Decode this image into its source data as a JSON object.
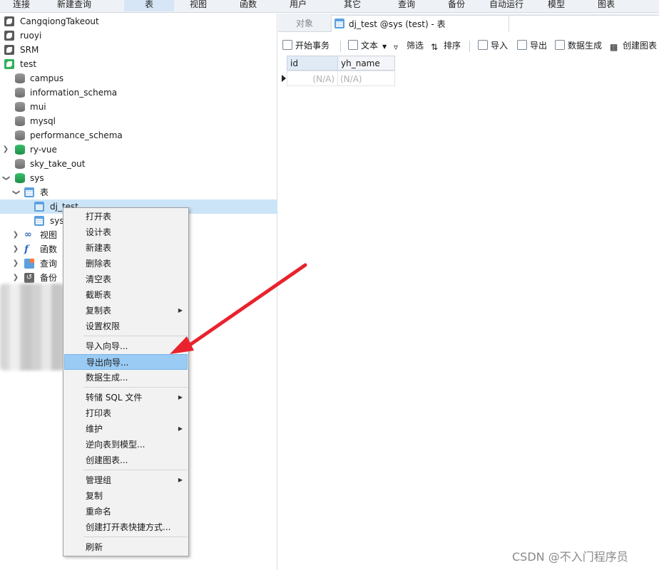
{
  "toolbar": {
    "items": [
      "连接",
      "新建查询",
      "表",
      "视图",
      "函数",
      "用户",
      "其它",
      "查询",
      "备份",
      "自动运行",
      "模型",
      "图表"
    ]
  },
  "tree": {
    "connections": [
      {
        "label": "CangqiongTakeout"
      },
      {
        "label": "ruoyi"
      },
      {
        "label": "SRM"
      },
      {
        "label": "test"
      }
    ],
    "databases": [
      {
        "label": "campus"
      },
      {
        "label": "information_schema"
      },
      {
        "label": "mui"
      },
      {
        "label": "mysql"
      },
      {
        "label": "performance_schema"
      },
      {
        "label": "ry-vue"
      },
      {
        "label": "sky_take_out"
      },
      {
        "label": "sys"
      }
    ],
    "sys_children": {
      "tables_label": "表",
      "tables": [
        "dj_test",
        "sys"
      ],
      "views_label": "视图",
      "functions_label": "函数",
      "queries_label": "查询",
      "backups_label": "备份"
    }
  },
  "tabs": {
    "objects": "对象",
    "active": "dj_test @sys (test) - 表"
  },
  "actions": {
    "begin_transaction": "开始事务",
    "text": "文本",
    "filter": "筛选",
    "sort": "排序",
    "import": "导入",
    "export": "导出",
    "data_generation": "数据生成",
    "create_chart": "创建图表"
  },
  "grid": {
    "columns": [
      "id",
      "yh_name"
    ],
    "rows": [
      [
        "(N/A)",
        "(N/A)"
      ]
    ]
  },
  "context_menu": {
    "groups": [
      [
        {
          "label": "打开表",
          "submenu": false
        },
        {
          "label": "设计表",
          "submenu": false
        },
        {
          "label": "新建表",
          "submenu": false
        },
        {
          "label": "删除表",
          "submenu": false
        },
        {
          "label": "清空表",
          "submenu": false
        },
        {
          "label": "截断表",
          "submenu": false
        },
        {
          "label": "复制表",
          "submenu": true
        },
        {
          "label": "设置权限",
          "submenu": false
        }
      ],
      [
        {
          "label": "导入向导...",
          "submenu": false
        },
        {
          "label": "导出向导...",
          "submenu": false,
          "highlighted": true
        },
        {
          "label": "数据生成...",
          "submenu": false
        }
      ],
      [
        {
          "label": "转储 SQL 文件",
          "submenu": true
        },
        {
          "label": "打印表",
          "submenu": false
        },
        {
          "label": "维护",
          "submenu": true
        },
        {
          "label": "逆向表到模型...",
          "submenu": false
        },
        {
          "label": "创建图表...",
          "submenu": false
        }
      ],
      [
        {
          "label": "管理组",
          "submenu": true
        },
        {
          "label": "复制",
          "submenu": false
        },
        {
          "label": "重命名",
          "submenu": false
        },
        {
          "label": "创建打开表快捷方式...",
          "submenu": false
        }
      ],
      [
        {
          "label": "刷新",
          "submenu": false
        }
      ]
    ]
  },
  "watermark": "CSDN @不入门程序员",
  "colors": {
    "accent_red": "#e8232d",
    "selection": "#cce4f7",
    "menu_highlight": "#99cbf4"
  }
}
